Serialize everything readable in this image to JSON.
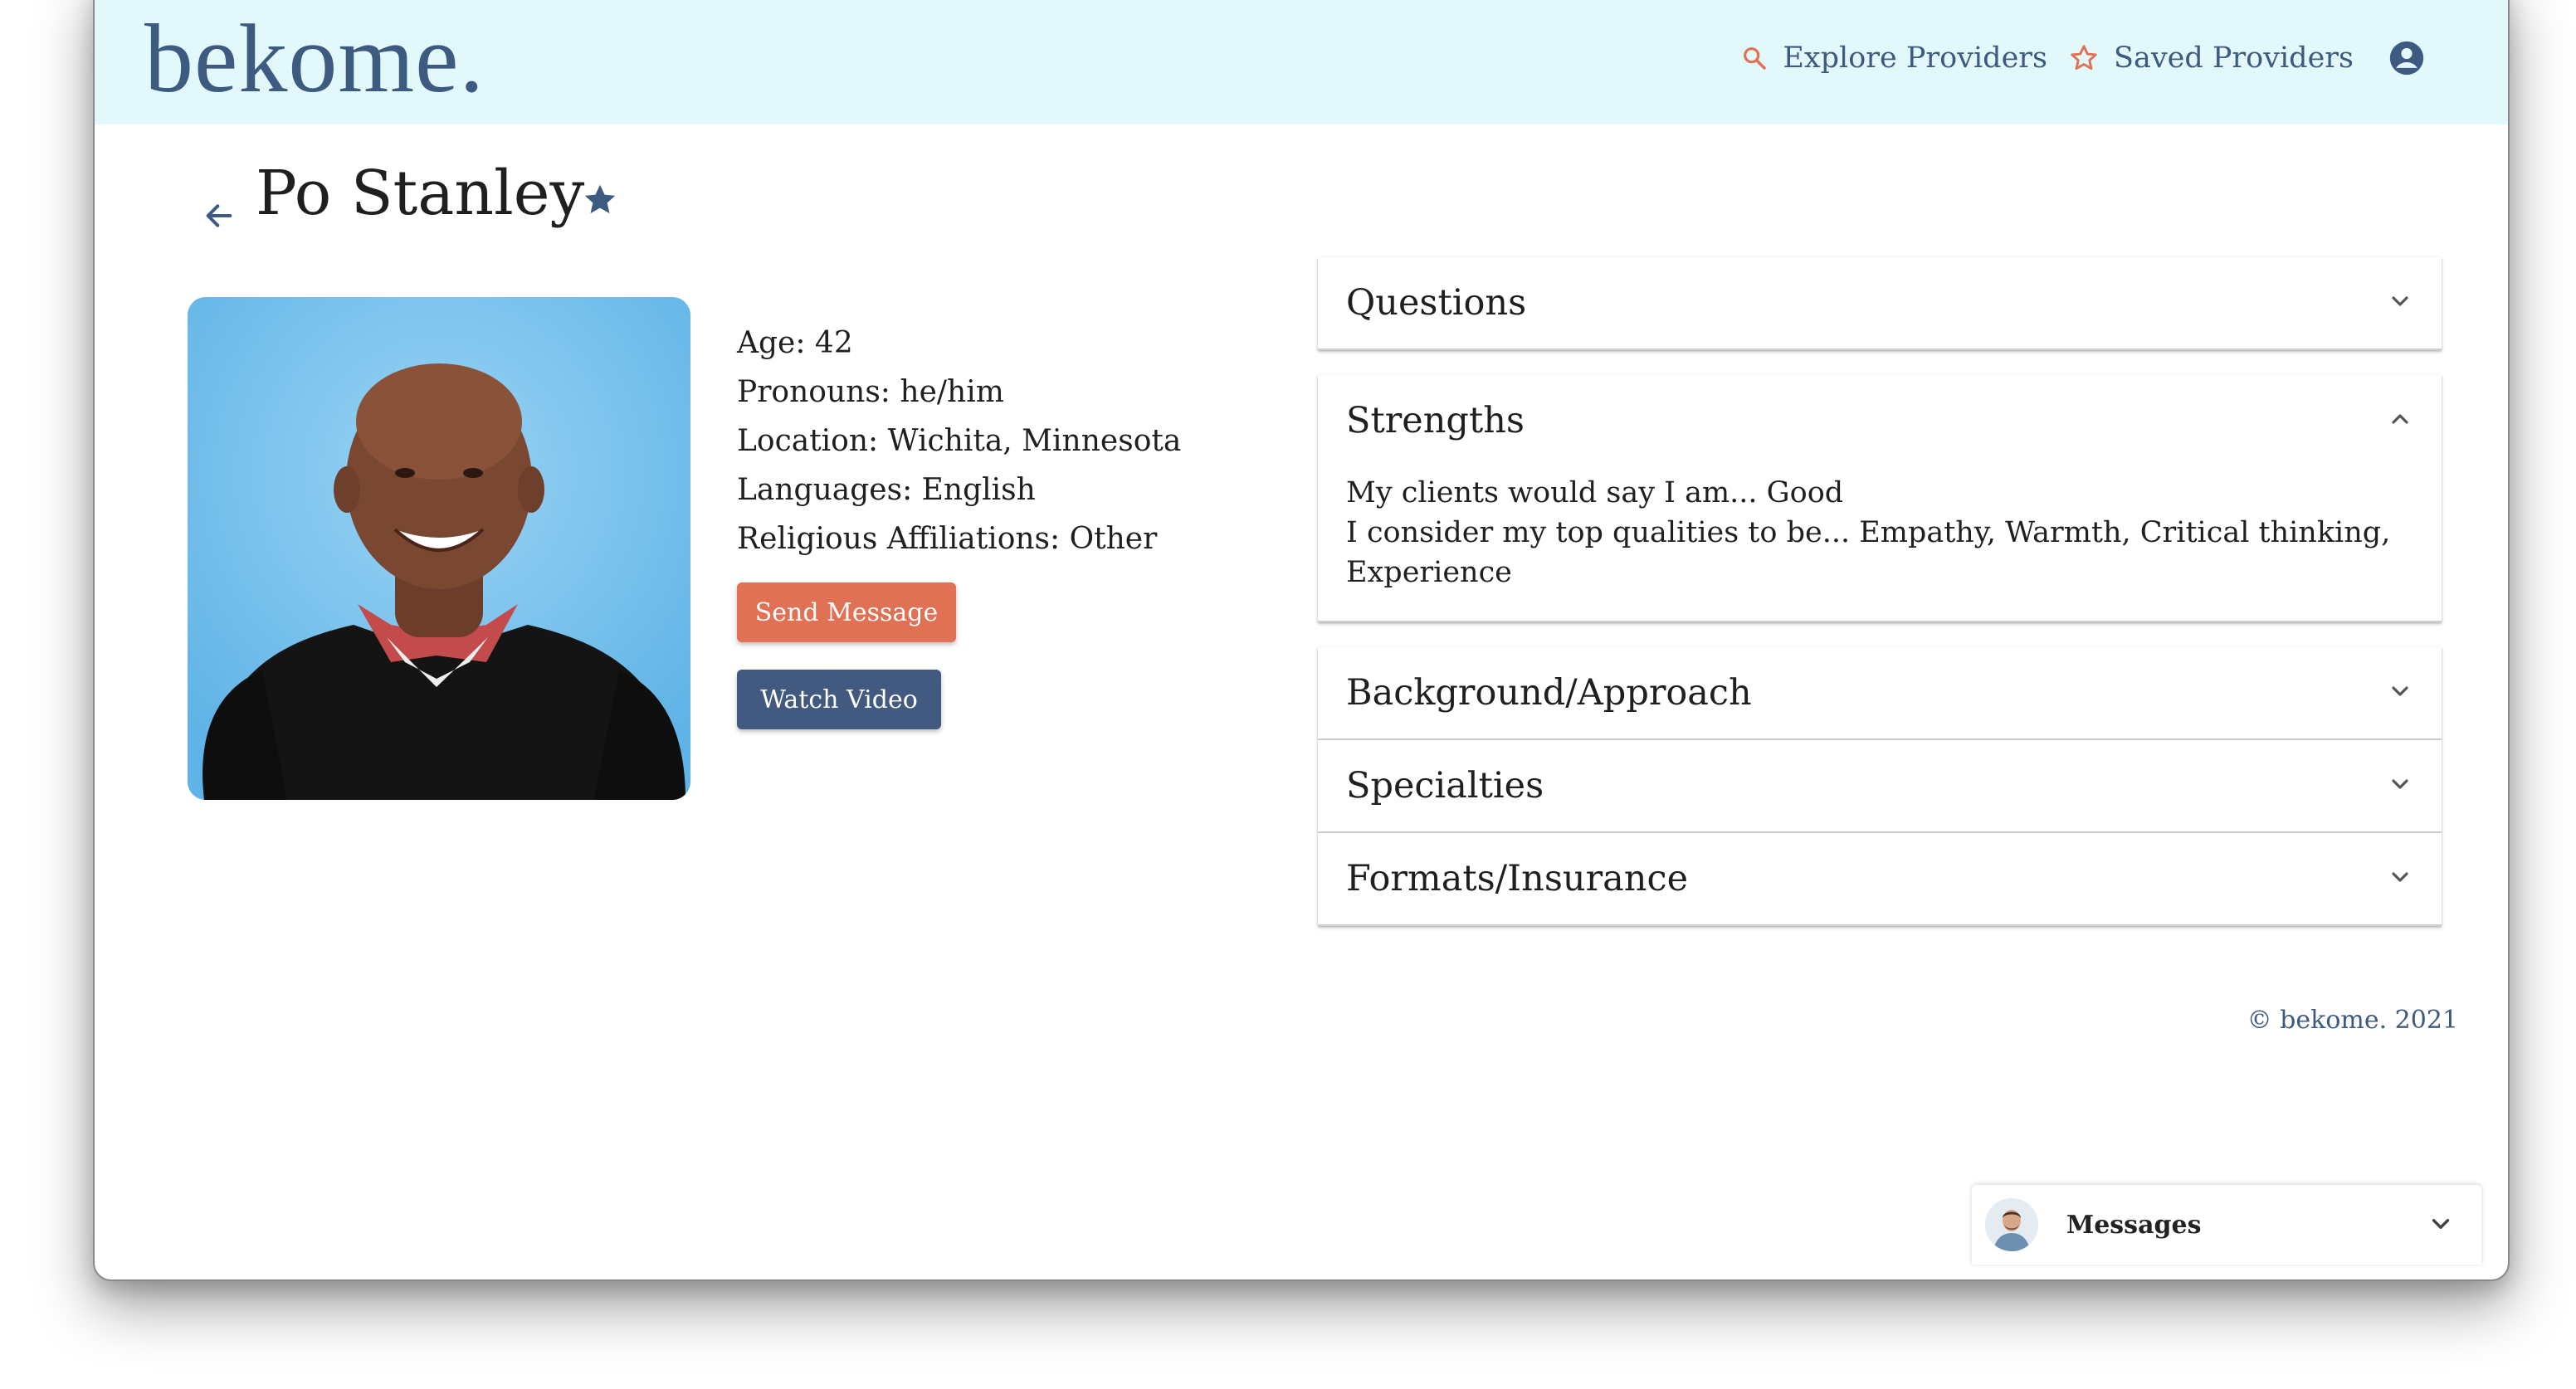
{
  "header": {
    "logo": "bekome.",
    "nav": {
      "explore_label": "Explore Providers",
      "saved_label": "Saved Providers"
    }
  },
  "profile": {
    "name": "Po Stanley",
    "info": {
      "age": "Age: 42",
      "pronouns": "Pronouns: he/him",
      "location": "Location: Wichita, Minnesota",
      "languages": "Languages: English",
      "religion": "Religious Affiliations: Other"
    },
    "send_message_label": "Send Message",
    "watch_video_label": "Watch Video"
  },
  "accordion": {
    "questions": {
      "title": "Questions",
      "expanded": false
    },
    "strengths": {
      "title": "Strengths",
      "expanded": true,
      "line1": "My clients would say I am... Good",
      "line2": "I consider my top qualities to be... Empathy, Warmth, Critical thinking, Experience"
    },
    "background": {
      "title": "Background/Approach",
      "expanded": false
    },
    "specialties": {
      "title": "Specialties",
      "expanded": false
    },
    "formats": {
      "title": "Formats/Insurance",
      "expanded": false
    }
  },
  "footer": {
    "copyright": "© bekome. 2021"
  },
  "messages": {
    "label": "Messages"
  },
  "colors": {
    "header_bg": "#e3f8fa",
    "brand_navy": "#3d5a80",
    "accent_coral": "#e07154",
    "button_navy": "#435a80"
  },
  "icons": {
    "explore": "search-icon",
    "saved": "star-outline-icon",
    "account": "account-circle-icon",
    "back": "arrow-left-icon",
    "favorite": "star-filled-icon",
    "expand": "chevron-down-icon",
    "collapse": "chevron-up-icon"
  }
}
